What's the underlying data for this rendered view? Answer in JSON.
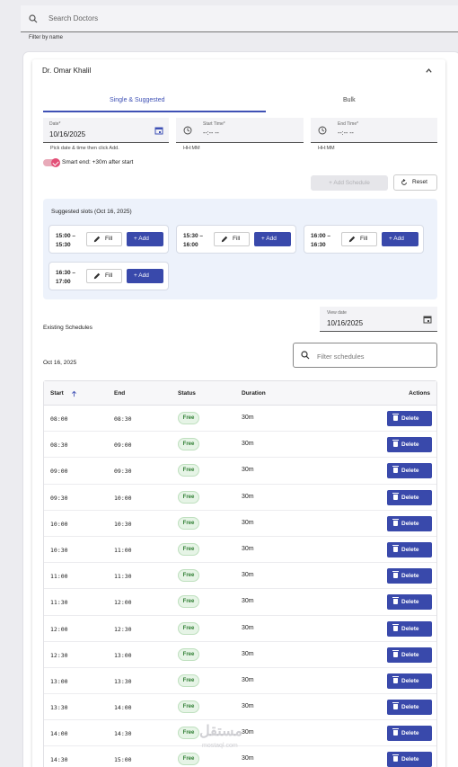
{
  "search": {
    "placeholder": "Search Doctors",
    "hint": "Filter by name"
  },
  "doctor": {
    "name": "Dr. Omar Khalil"
  },
  "tabs": [
    {
      "label": "Single & Suggested",
      "active": true
    },
    {
      "label": "Bulk",
      "active": false
    }
  ],
  "form": {
    "date_label": "Date*",
    "date_value": "10/16/2025",
    "date_hint": "Pick date & time then click Add.",
    "start_label": "Start Time*",
    "start_value": "--:-- --",
    "start_hint": "HH:MM",
    "end_label": "End Time*",
    "end_value": "--:-- --",
    "end_hint": "HH:MM",
    "smart_end_label": "Smart end: +30m after start",
    "smart_end_on": true,
    "add_schedule_label": "+ Add Schedule",
    "reset_label": "Reset"
  },
  "suggested": {
    "title": "Suggested slots (Oct 16, 2025)",
    "fill_label": "Fill",
    "add_label": "+ Add",
    "slots": [
      {
        "start": "15:00 –",
        "end": "15:30"
      },
      {
        "start": "15:30 –",
        "end": "16:00"
      },
      {
        "start": "16:00 –",
        "end": "16:30"
      },
      {
        "start": "16:30 –",
        "end": "17:00"
      }
    ]
  },
  "existing": {
    "title": "Existing Schedules",
    "view_date_label": "View date",
    "view_date_value": "10/16/2025",
    "date_label": "Oct 16, 2025",
    "filter_placeholder": "Filter schedules"
  },
  "table": {
    "columns": [
      "Start",
      "End",
      "Status",
      "Duration",
      "Actions"
    ],
    "delete_label": "Delete",
    "rows": [
      {
        "start": "08:00",
        "end": "08:30",
        "status": "Free",
        "duration": "30m"
      },
      {
        "start": "08:30",
        "end": "09:00",
        "status": "Free",
        "duration": "30m"
      },
      {
        "start": "09:00",
        "end": "09:30",
        "status": "Free",
        "duration": "30m"
      },
      {
        "start": "09:30",
        "end": "10:00",
        "status": "Free",
        "duration": "30m"
      },
      {
        "start": "10:00",
        "end": "10:30",
        "status": "Free",
        "duration": "30m"
      },
      {
        "start": "10:30",
        "end": "11:00",
        "status": "Free",
        "duration": "30m"
      },
      {
        "start": "11:00",
        "end": "11:30",
        "status": "Free",
        "duration": "30m"
      },
      {
        "start": "11:30",
        "end": "12:00",
        "status": "Free",
        "duration": "30m"
      },
      {
        "start": "12:00",
        "end": "12:30",
        "status": "Free",
        "duration": "30m"
      },
      {
        "start": "12:30",
        "end": "13:00",
        "status": "Free",
        "duration": "30m"
      },
      {
        "start": "13:00",
        "end": "13:30",
        "status": "Free",
        "duration": "30m"
      },
      {
        "start": "13:30",
        "end": "14:00",
        "status": "Free",
        "duration": "30m"
      },
      {
        "start": "14:00",
        "end": "14:30",
        "status": "Free",
        "duration": "30m"
      },
      {
        "start": "14:30",
        "end": "15:00",
        "status": "Free",
        "duration": "30m"
      }
    ]
  },
  "watermark": {
    "text": "مستقل",
    "sub": "mostaql.com"
  },
  "colors": {
    "primary": "#3949ab",
    "accent": "#e34f77",
    "success": "#2e7d32"
  }
}
